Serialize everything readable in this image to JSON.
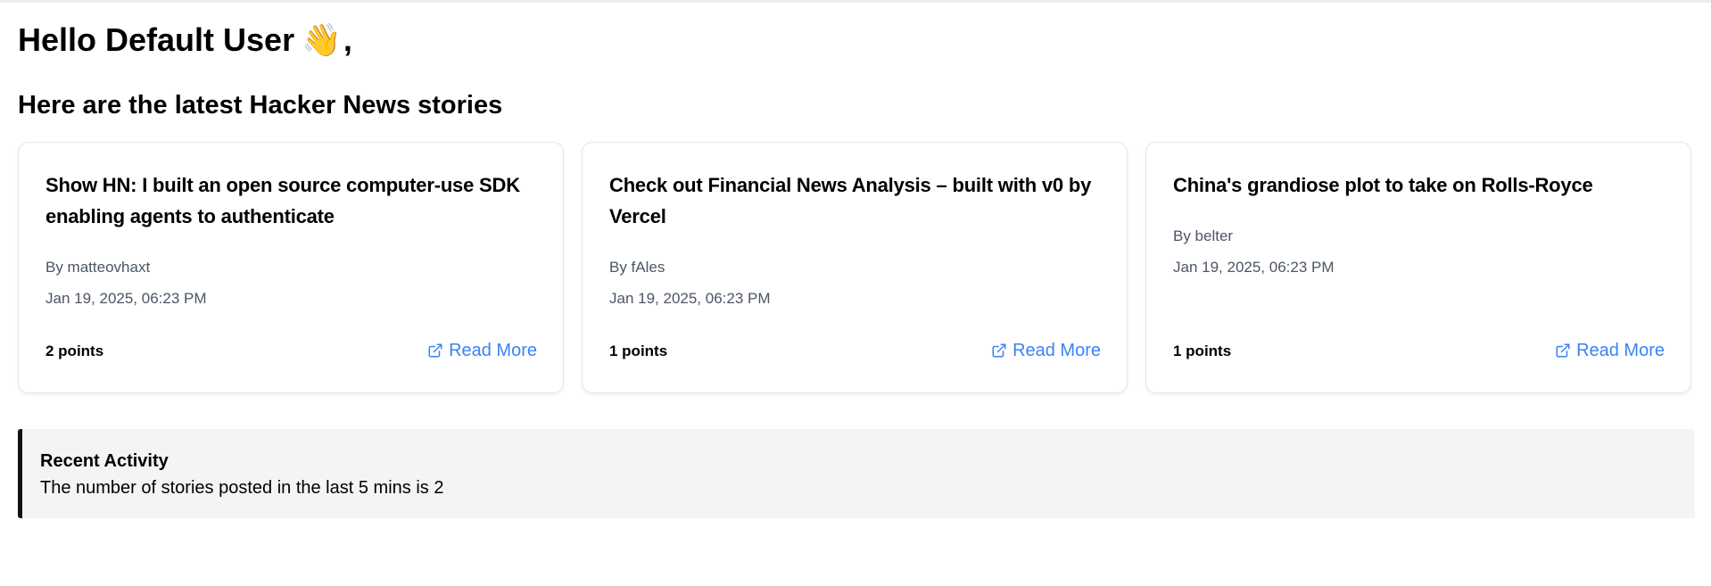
{
  "header": {
    "greeting": "Hello Default User",
    "wave": "👋",
    "greeting_suffix": ",",
    "subtitle": "Here are the latest Hacker News stories"
  },
  "stories": [
    {
      "title": "Show HN: I built an open source computer-use SDK enabling agents to authenticate",
      "author": "By matteovhaxt",
      "date": "Jan 19, 2025, 06:23 PM",
      "points": "2 points",
      "link_label": "Read More",
      "link_icon": "external-link-icon"
    },
    {
      "title": "Check out Financial News Analysis – built with v0 by Vercel",
      "author": "By fAles",
      "date": "Jan 19, 2025, 06:23 PM",
      "points": "1 points",
      "link_label": "Read More",
      "link_icon": "external-link-icon"
    },
    {
      "title": "China's grandiose plot to take on Rolls-Royce",
      "author": "By belter",
      "date": "Jan 19, 2025, 06:23 PM",
      "points": "1 points",
      "link_label": "Read More",
      "link_icon": "external-link-icon"
    }
  ],
  "activity": {
    "title": "Recent Activity",
    "text": "The number of stories posted in the last 5 mins is 2"
  },
  "colors": {
    "link": "#3b82f6",
    "muted_text": "#4b5563",
    "activity_background": "#f3f4f6",
    "activity_accent": "#111111"
  }
}
